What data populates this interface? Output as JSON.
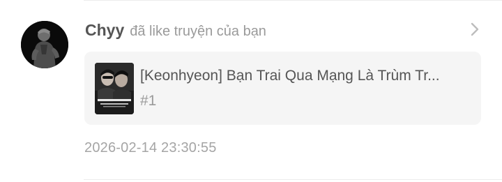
{
  "notification": {
    "username": "Chyy",
    "action_text": "đã like truyện của bạn",
    "story": {
      "title": "[Keonhyeon] Bạn Trai Qua Mạng Là Trùm Tr...",
      "chapter": "#1"
    },
    "timestamp": "2026-02-14 23:30:55"
  },
  "icons": {
    "avatar": "user-avatar-image",
    "chevron": "chevron-right-icon",
    "cover": "story-cover-image"
  },
  "colors": {
    "username": "#555555",
    "secondary_text": "#9a9a9a",
    "card_background": "#f5f5f5",
    "chevron": "#bdbdbd"
  }
}
